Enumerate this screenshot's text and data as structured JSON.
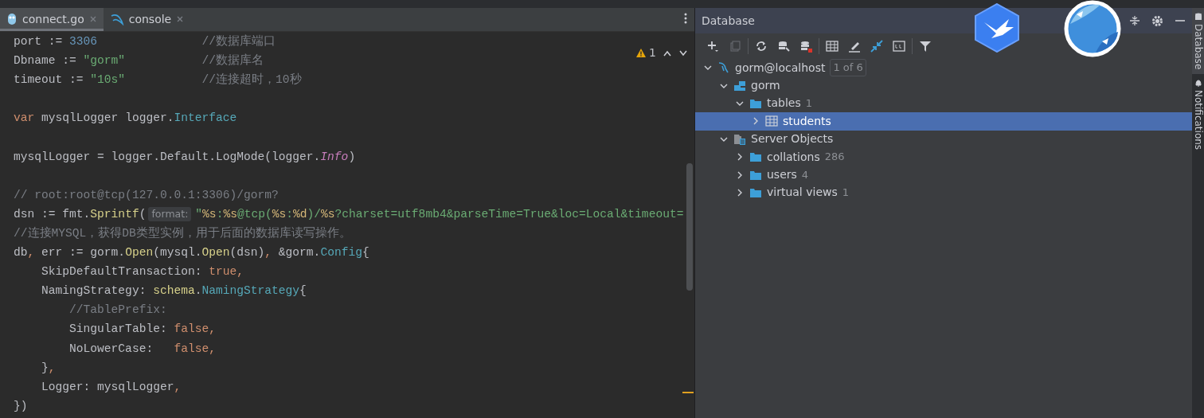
{
  "editor": {
    "tabs": [
      {
        "label": "connect.go",
        "kind": "go",
        "selected": true
      },
      {
        "label": "console",
        "kind": "sql",
        "selected": false
      }
    ],
    "warnings": "1",
    "lines": [
      {
        "kind": "code",
        "tokens": [
          {
            "kind": "plain",
            "text": "port := "
          },
          {
            "kind": "num",
            "text": "3306"
          },
          {
            "kind": "comment",
            "text": "               //数据库端口"
          }
        ]
      },
      {
        "kind": "code",
        "tokens": [
          {
            "kind": "plain",
            "text": "Dbname := "
          },
          {
            "kind": "str",
            "text": "\"gorm\""
          },
          {
            "kind": "comment",
            "text": "           //数据库名"
          }
        ]
      },
      {
        "kind": "code",
        "tokens": [
          {
            "kind": "plain",
            "text": "timeout := "
          },
          {
            "kind": "str",
            "text": "\"10s\""
          },
          {
            "kind": "comment",
            "text": "           //连接超时，10秒"
          }
        ]
      },
      {
        "kind": "blank"
      },
      {
        "kind": "code",
        "tokens": [
          {
            "kind": "kw",
            "text": "var"
          },
          {
            "kind": "plain",
            "text": " mysqlLogger logger."
          },
          {
            "kind": "type",
            "text": "Interface"
          }
        ]
      },
      {
        "kind": "blank"
      },
      {
        "kind": "code",
        "tokens": [
          {
            "kind": "plain",
            "text": "mysqlLogger = logger.Default.LogMode(logger."
          },
          {
            "kind": "const",
            "text": "Info"
          },
          {
            "kind": "plain",
            "text": ")"
          }
        ]
      },
      {
        "kind": "blank"
      },
      {
        "kind": "code",
        "tokens": [
          {
            "kind": "comment",
            "text": "// root:root@tcp(127.0.0.1:3306)/gorm?"
          }
        ]
      },
      {
        "kind": "code",
        "tokens": [
          {
            "kind": "plain",
            "text": "dsn := fmt."
          },
          {
            "kind": "func",
            "text": "Sprintf"
          },
          {
            "kind": "plain",
            "text": "("
          },
          {
            "kind": "hint",
            "text": "format:"
          },
          {
            "kind": "str",
            "text": "\""
          },
          {
            "kind": "fmt",
            "text": "%s"
          },
          {
            "kind": "str",
            "text": ":"
          },
          {
            "kind": "fmt",
            "text": "%s"
          },
          {
            "kind": "str",
            "text": "@tcp("
          },
          {
            "kind": "fmt",
            "text": "%s"
          },
          {
            "kind": "str",
            "text": ":"
          },
          {
            "kind": "fmt",
            "text": "%d"
          },
          {
            "kind": "str",
            "text": ")/"
          },
          {
            "kind": "fmt",
            "text": "%s"
          },
          {
            "kind": "str",
            "text": "?charset=utf8mb4&parseTime=True&loc=Local&timeout="
          }
        ]
      },
      {
        "kind": "code",
        "tokens": [
          {
            "kind": "comment",
            "text": "//连接MYSQL，获得DB类型实例，用于后面的数据库读写操作。"
          }
        ]
      },
      {
        "kind": "code",
        "tokens": [
          {
            "kind": "plain",
            "text": "db"
          },
          {
            "kind": "kw",
            "text": ","
          },
          {
            "kind": "plain",
            "text": " err := gorm."
          },
          {
            "kind": "func",
            "text": "Open"
          },
          {
            "kind": "plain",
            "text": "(mysql."
          },
          {
            "kind": "func",
            "text": "Open"
          },
          {
            "kind": "plain",
            "text": "(dsn)"
          },
          {
            "kind": "kw",
            "text": ","
          },
          {
            "kind": "plain",
            "text": " &gorm."
          },
          {
            "kind": "type",
            "text": "Config"
          },
          {
            "kind": "plain",
            "text": "{"
          }
        ]
      },
      {
        "kind": "code",
        "tokens": [
          {
            "kind": "plain",
            "text": "    SkipDefaultTransaction: "
          },
          {
            "kind": "kw",
            "text": "true,"
          }
        ]
      },
      {
        "kind": "code",
        "tokens": [
          {
            "kind": "plain",
            "text": "    NamingStrategy: "
          },
          {
            "kind": "func",
            "text": "schema"
          },
          {
            "kind": "plain",
            "text": "."
          },
          {
            "kind": "type",
            "text": "NamingStrategy"
          },
          {
            "kind": "plain",
            "text": "{"
          }
        ]
      },
      {
        "kind": "code",
        "tokens": [
          {
            "kind": "comment",
            "text": "        //TablePrefix:"
          }
        ]
      },
      {
        "kind": "code",
        "tokens": [
          {
            "kind": "plain",
            "text": "        SingularTable: "
          },
          {
            "kind": "kw",
            "text": "false,"
          }
        ]
      },
      {
        "kind": "code",
        "tokens": [
          {
            "kind": "plain",
            "text": "        NoLowerCase:   "
          },
          {
            "kind": "kw",
            "text": "false,"
          }
        ]
      },
      {
        "kind": "code",
        "tokens": [
          {
            "kind": "plain",
            "text": "    }"
          },
          {
            "kind": "kw",
            "text": ","
          }
        ]
      },
      {
        "kind": "code",
        "tokens": [
          {
            "kind": "plain",
            "text": "    Logger: mysqlLogger"
          },
          {
            "kind": "kw",
            "text": ","
          }
        ]
      },
      {
        "kind": "code",
        "tokens": [
          {
            "kind": "plain",
            "text": "})"
          }
        ]
      }
    ]
  },
  "database": {
    "title": "Database",
    "tree": [
      {
        "label": "gorm@localhost",
        "kind": "datasource",
        "badge": "1 of 6",
        "expanded": true,
        "selected": false,
        "children": [
          {
            "label": "gorm",
            "kind": "schema",
            "expanded": true,
            "selected": false,
            "children": [
              {
                "label": "tables",
                "kind": "folder",
                "count": "1",
                "expanded": true,
                "selected": false,
                "children": [
                  {
                    "label": "students",
                    "kind": "table",
                    "expanded": false,
                    "selected": true
                  }
                ]
              }
            ]
          },
          {
            "label": "Server Objects",
            "kind": "server",
            "expanded": true,
            "selected": false,
            "children": [
              {
                "label": "collations",
                "kind": "folder",
                "count": "286",
                "expanded": false,
                "selected": false
              },
              {
                "label": "users",
                "kind": "folder",
                "count": "4",
                "expanded": false,
                "selected": false
              },
              {
                "label": "virtual views",
                "kind": "folder",
                "count": "1",
                "expanded": false,
                "selected": false
              }
            ]
          }
        ]
      }
    ]
  },
  "side_tabs": [
    {
      "label": "Database",
      "kind": "database",
      "selected": true
    },
    {
      "label": "Notifications",
      "kind": "bell",
      "selected": false
    }
  ]
}
